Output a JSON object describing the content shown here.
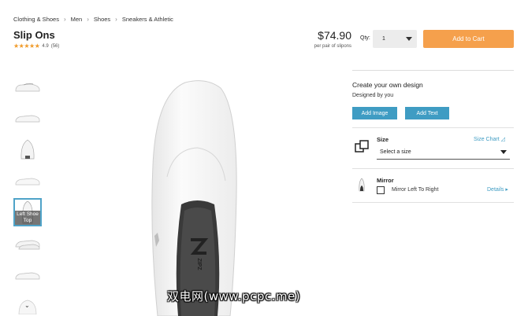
{
  "breadcrumb": [
    "Clothing & Shoes",
    "Men",
    "Shoes",
    "Sneakers & Athletic"
  ],
  "breadcrumb_separator": "›",
  "product": {
    "title": "Slip Ons",
    "stars": "★★★★★",
    "rating": "4.9",
    "review_count": "(56)",
    "price": "$74.90",
    "price_sub": "per pair of slipons"
  },
  "purchase": {
    "qty_label": "Qty:",
    "qty_value": "1",
    "add_to_cart": "Add to Cart"
  },
  "thumbnails": {
    "active_overlay": "Left Shoe Top",
    "more_arrow": "⌄"
  },
  "design": {
    "title": "Create your own design",
    "subtitle": "Designed by you",
    "add_image": "Add Image",
    "add_text": "Add Text"
  },
  "size": {
    "label": "Size",
    "chart_link": "Size Chart ◿",
    "select_placeholder": "Select a size"
  },
  "mirror": {
    "label": "Mirror",
    "option": "Mirror Left To Right",
    "details": "Details ▸"
  },
  "watermark": "双电网(www.pcpc.me)",
  "colors": {
    "accent_orange": "#f5a04c",
    "accent_blue": "#3f9cc3",
    "star": "#f09b2a"
  }
}
